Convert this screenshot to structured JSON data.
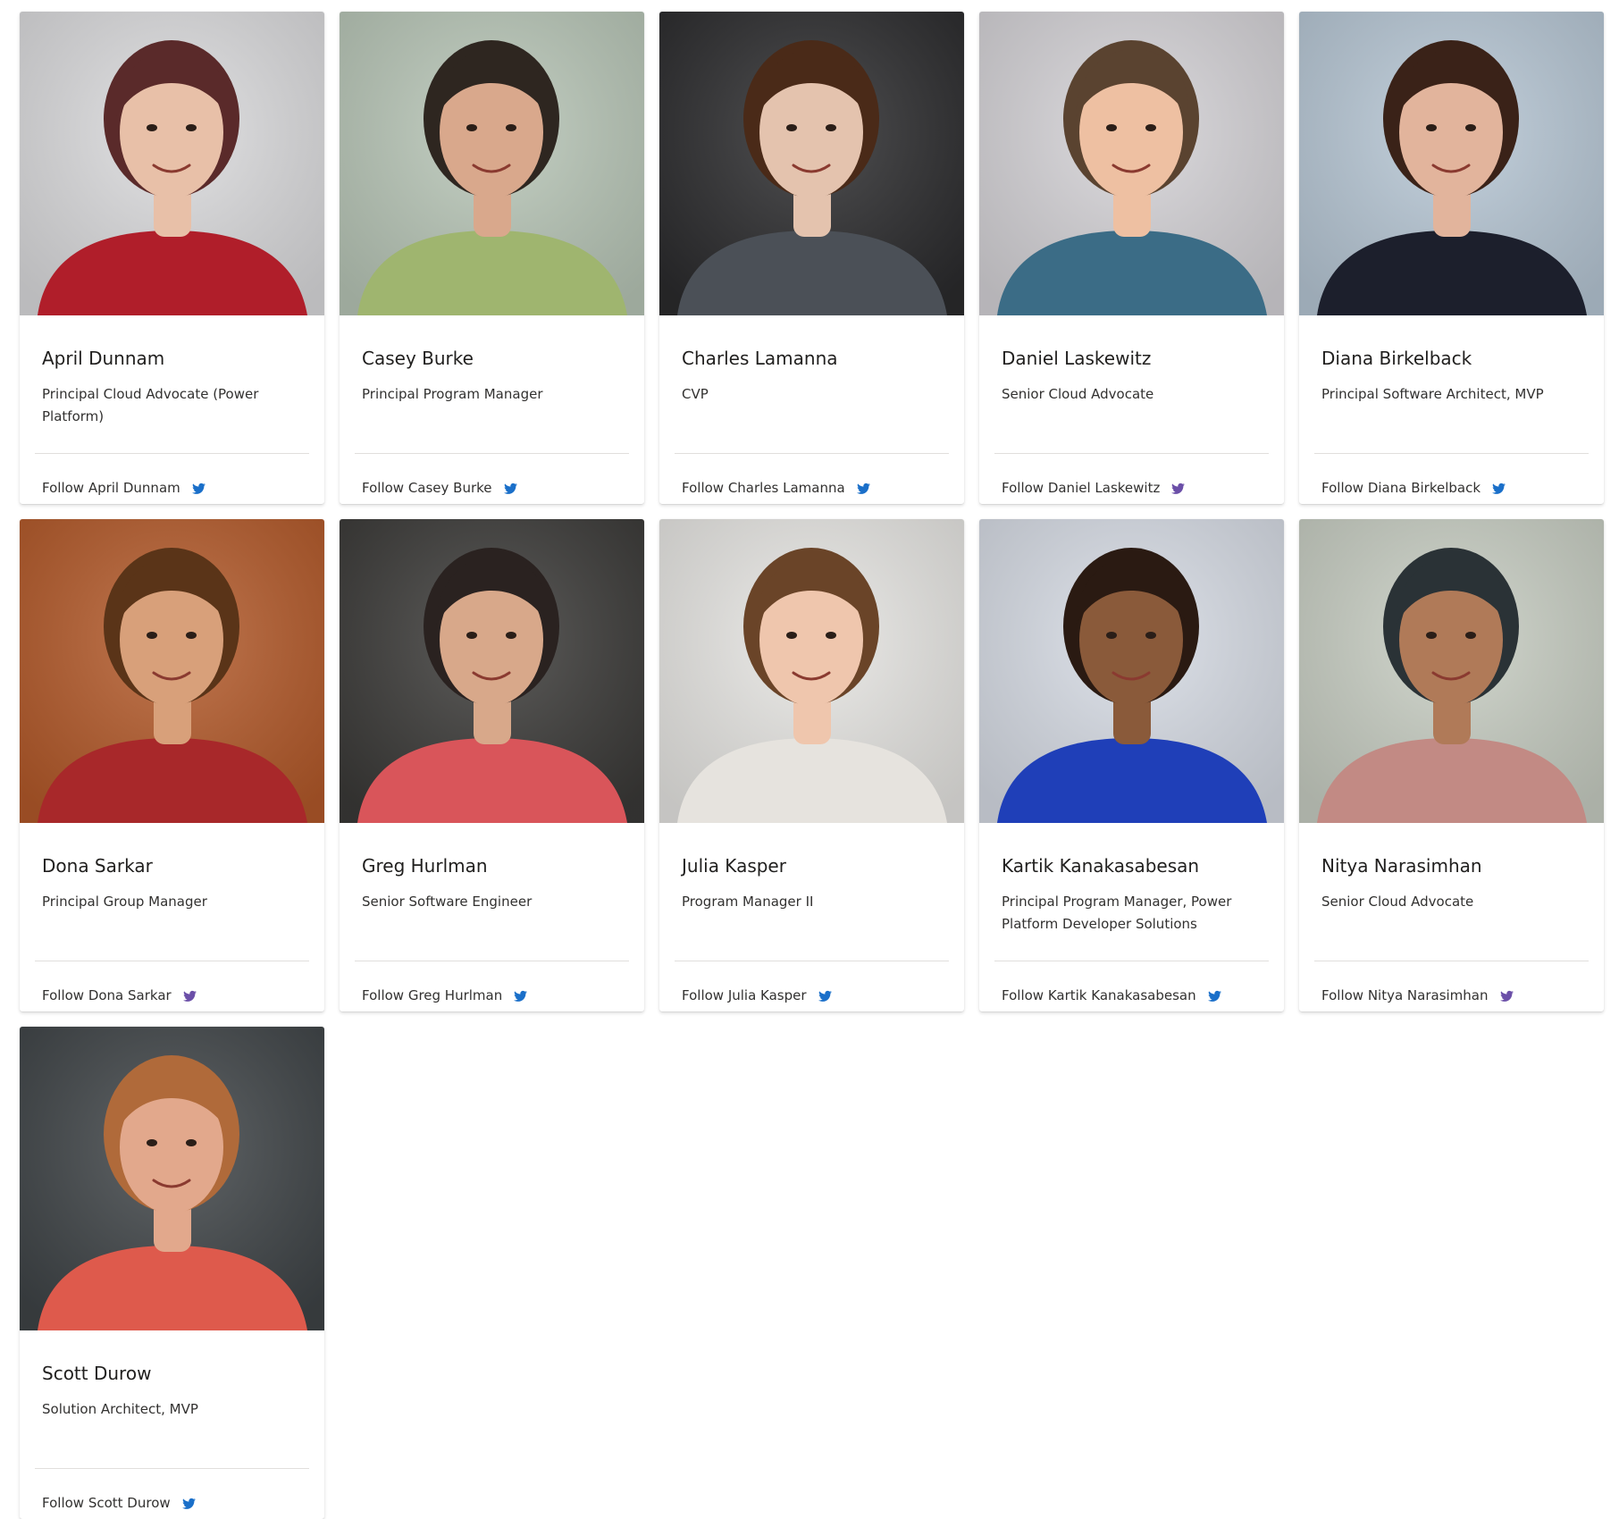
{
  "twitter_colors": {
    "blue": "#1a6fc9",
    "purple": "#6b4fa8"
  },
  "people": [
    {
      "name": "April Dunnam",
      "role": "Principal Cloud Advocate (Power Platform)",
      "follow_label": "Follow April Dunnam",
      "icon": "twitter-icon",
      "icon_color": "blue",
      "photo": {
        "bg": "#dcdcde",
        "skin": "#e8c0a8",
        "hair": "#5a2a2a",
        "shirt": "#b01e2a"
      }
    },
    {
      "name": "Casey Burke",
      "role": "Principal Program Manager",
      "follow_label": "Follow Casey Burke",
      "icon": "twitter-icon",
      "icon_color": "blue",
      "photo": {
        "bg": "#b9c7b8",
        "skin": "#d9a88c",
        "hair": "#2e2620",
        "shirt": "#9fb56f"
      }
    },
    {
      "name": "Charles Lamanna",
      "role": "CVP",
      "follow_label": "Follow Charles Lamanna",
      "icon": "twitter-icon",
      "icon_color": "blue",
      "photo": {
        "bg": "#2b2b2d",
        "skin": "#e4c3ae",
        "hair": "#4a2a18",
        "shirt": "#4b5057"
      }
    },
    {
      "name": "Daniel Laskewitz",
      "role": "Senior Cloud Advocate",
      "follow_label": "Follow Daniel Laskewitz",
      "icon": "twitter-icon",
      "icon_color": "purple",
      "photo": {
        "bg": "#d6d4d8",
        "skin": "#eec0a2",
        "hair": "#5a4330",
        "shirt": "#3b6c86"
      }
    },
    {
      "name": "Diana Birkelback",
      "role": "Principal Software Architect, MVP",
      "follow_label": "Follow Diana Birkelback",
      "icon": "twitter-icon",
      "icon_color": "blue",
      "photo": {
        "bg": "#b8c8d6",
        "skin": "#e2b49c",
        "hair": "#3a2218",
        "shirt": "#1c1f2c"
      }
    },
    {
      "name": "Dona Sarkar",
      "role": "Principal Group Manager",
      "follow_label": "Follow Dona Sarkar",
      "icon": "twitter-icon",
      "icon_color": "purple",
      "photo": {
        "bg": "#b45a2a",
        "skin": "#d8a07a",
        "hair": "#5a3418",
        "shirt": "#a8282a"
      }
    },
    {
      "name": "Greg Hurlman",
      "role": "Senior Software Engineer",
      "follow_label": "Follow Greg Hurlman",
      "icon": "twitter-icon",
      "icon_color": "blue",
      "photo": {
        "bg": "#3b3a38",
        "skin": "#d8a88a",
        "hair": "#2a2220",
        "shirt": "#d9555a"
      }
    },
    {
      "name": "Julia Kasper",
      "role": "Program Manager II",
      "follow_label": "Follow Julia Kasper",
      "icon": "twitter-icon",
      "icon_color": "blue",
      "photo": {
        "bg": "#e8e7e4",
        "skin": "#efc6ad",
        "hair": "#6a4428",
        "shirt": "#e6e3de"
      }
    },
    {
      "name": "Kartik Kanakasabesan",
      "role": "Principal Program Manager, Power Platform Developer Solutions",
      "follow_label": "Follow Kartik Kanakasabesan",
      "icon": "twitter-icon",
      "icon_color": "blue",
      "photo": {
        "bg": "#d8dde6",
        "skin": "#8a5a3a",
        "hair": "#2a1a12",
        "shirt": "#1f3fb8"
      }
    },
    {
      "name": "Nitya Narasimhan",
      "role": "Senior Cloud Advocate",
      "follow_label": "Follow Nitya Narasimhan",
      "icon": "twitter-icon",
      "icon_color": "purple",
      "photo": {
        "bg": "#c9cfc4",
        "skin": "#b07a58",
        "hair": "#2a3236",
        "shirt": "#c28a84"
      }
    },
    {
      "name": "Scott Durow",
      "role": "Solution Architect, MVP",
      "follow_label": "Follow Scott Durow",
      "icon": "twitter-icon",
      "icon_color": "blue",
      "photo": {
        "bg": "#3f4447",
        "skin": "#e2a88c",
        "hair": "#b06a3a",
        "shirt": "#de5a4c"
      }
    }
  ]
}
